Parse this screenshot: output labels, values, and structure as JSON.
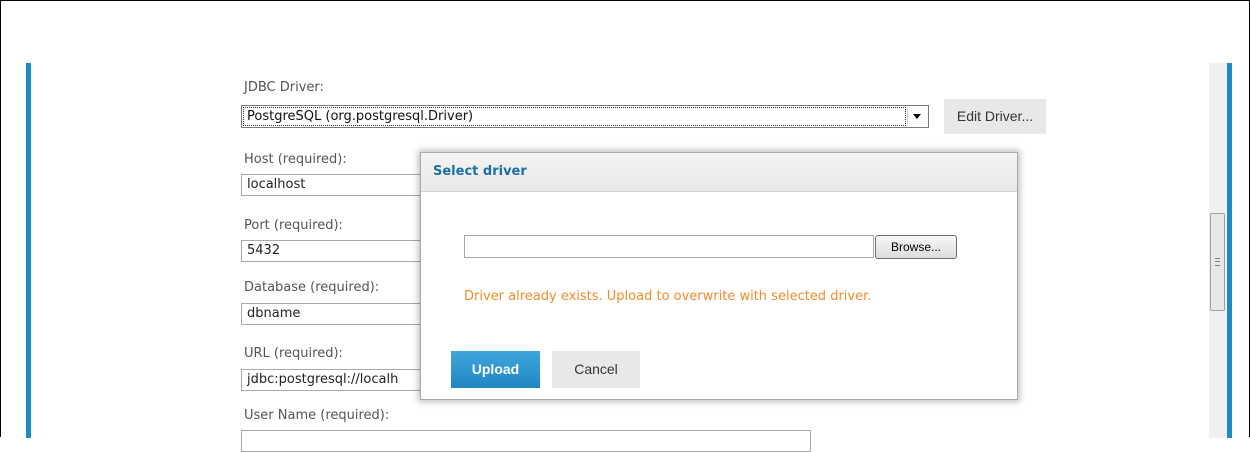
{
  "form": {
    "jdbc_driver_label": "JDBC Driver:",
    "jdbc_driver_value": "PostgreSQL (org.postgresql.Driver)",
    "edit_driver_label": "Edit Driver...",
    "host_label": "Host (required):",
    "host_value": "localhost",
    "port_label": "Port (required):",
    "port_value": "5432",
    "database_label": "Database (required):",
    "database_value": "dbname",
    "url_label": "URL (required):",
    "url_value": "jdbc:postgresql://localh",
    "username_label": "User Name (required):",
    "username_value": ""
  },
  "dialog": {
    "title": "Select driver",
    "file_value": "",
    "browse_label": "Browse...",
    "warning": "Driver already exists. Upload to overwrite with selected driver.",
    "upload_label": "Upload",
    "cancel_label": "Cancel"
  },
  "colors": {
    "accent": "#1e8bc3",
    "title": "#1d6fa5",
    "warning": "#f08c28"
  }
}
